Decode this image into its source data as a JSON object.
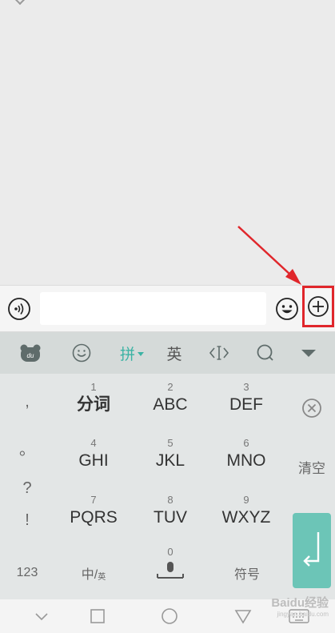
{
  "input_bar": {
    "message_value": "",
    "icons": {
      "voice": "voice-icon",
      "emoji": "emoji-icon",
      "plus": "plus-circle-icon"
    },
    "highlight_color": "#e0262b"
  },
  "annotation": {
    "arrow_color": "#e0262b"
  },
  "keyboard": {
    "toolbar": {
      "pinyin_label": "拼",
      "english_label": "英",
      "icons": [
        "du-logo-icon",
        "emoji-icon",
        "cursor-icon",
        "search-icon",
        "collapse-icon"
      ]
    },
    "punctuation": [
      ",",
      "。",
      "?",
      "!"
    ],
    "keys": [
      {
        "num": "1",
        "label": "分词"
      },
      {
        "num": "2",
        "label": "ABC"
      },
      {
        "num": "3",
        "label": "DEF"
      },
      {
        "num": "4",
        "label": "GHI"
      },
      {
        "num": "5",
        "label": "JKL"
      },
      {
        "num": "6",
        "label": "MNO"
      },
      {
        "num": "7",
        "label": "PQRS"
      },
      {
        "num": "8",
        "label": "TUV"
      },
      {
        "num": "9",
        "label": "WXYZ"
      }
    ],
    "clear_label": "清空",
    "bottom": {
      "numbers_label": "123",
      "lang_label_main": "中/",
      "lang_label_small": "英",
      "space_num": "0",
      "symbols_label": "符号"
    },
    "accent_color": "#3cb3a4",
    "enter_color": "#6cc5b7"
  },
  "watermark": {
    "main": "Baidu经验",
    "sub": "jingyan.baidu.com"
  }
}
